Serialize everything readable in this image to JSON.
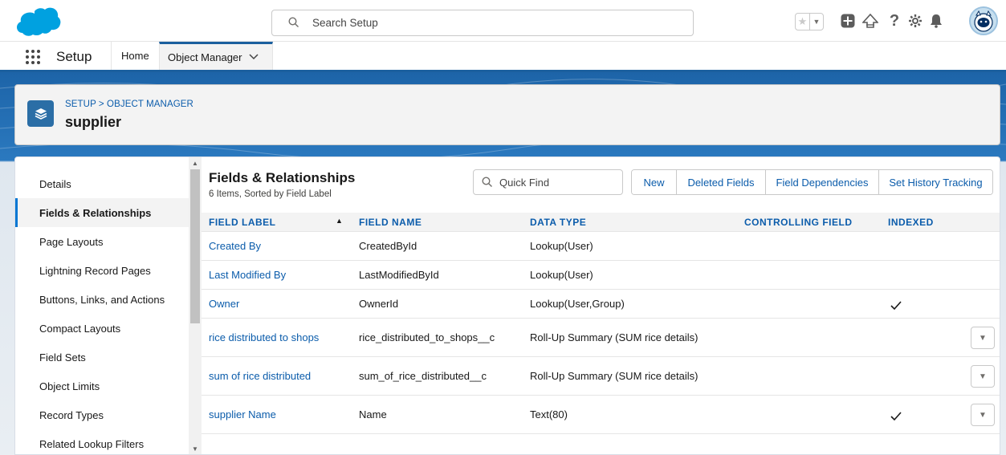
{
  "header": {
    "search_placeholder": "Search Setup"
  },
  "context_bar": {
    "app_name": "Setup",
    "tabs": [
      {
        "label": "Home"
      },
      {
        "label": "Object Manager"
      }
    ]
  },
  "page_header": {
    "breadcrumb": "SETUP > OBJECT MANAGER",
    "title": "supplier"
  },
  "sidebar": {
    "items": [
      {
        "label": "Details"
      },
      {
        "label": "Fields & Relationships"
      },
      {
        "label": "Page Layouts"
      },
      {
        "label": "Lightning Record Pages"
      },
      {
        "label": "Buttons, Links, and Actions"
      },
      {
        "label": "Compact Layouts"
      },
      {
        "label": "Field Sets"
      },
      {
        "label": "Object Limits"
      },
      {
        "label": "Record Types"
      },
      {
        "label": "Related Lookup Filters"
      }
    ]
  },
  "section": {
    "title": "Fields & Relationships",
    "subtitle": "6 Items, Sorted by Field Label",
    "quick_find_placeholder": "Quick Find",
    "buttons": {
      "new": "New",
      "deleted_fields": "Deleted Fields",
      "field_dependencies": "Field Dependencies",
      "set_history_tracking": "Set History Tracking"
    }
  },
  "table": {
    "columns": {
      "field_label": "FIELD LABEL",
      "field_name": "FIELD NAME",
      "data_type": "DATA TYPE",
      "controlling_field": "CONTROLLING FIELD",
      "indexed": "INDEXED"
    },
    "rows": [
      {
        "label": "Created By",
        "name": "CreatedById",
        "type": "Lookup(User)",
        "controlling": "",
        "indexed": false,
        "has_action": false
      },
      {
        "label": "Last Modified By",
        "name": "LastModifiedById",
        "type": "Lookup(User)",
        "controlling": "",
        "indexed": false,
        "has_action": false
      },
      {
        "label": "Owner",
        "name": "OwnerId",
        "type": "Lookup(User,Group)",
        "controlling": "",
        "indexed": true,
        "has_action": false
      },
      {
        "label": "rice distributed to shops",
        "name": "rice_distributed_to_shops__c",
        "type": "Roll-Up Summary (SUM rice details)",
        "controlling": "",
        "indexed": false,
        "has_action": true
      },
      {
        "label": "sum of rice distributed",
        "name": "sum_of_rice_distributed__c",
        "type": "Roll-Up Summary (SUM rice details)",
        "controlling": "",
        "indexed": false,
        "has_action": true
      },
      {
        "label": "supplier Name",
        "name": "Name",
        "type": "Text(80)",
        "controlling": "",
        "indexed": true,
        "has_action": true
      }
    ]
  },
  "colors": {
    "brand_blue": "#0b5cab",
    "header_band": "#1d64a8",
    "logo": "#00a1e0"
  }
}
